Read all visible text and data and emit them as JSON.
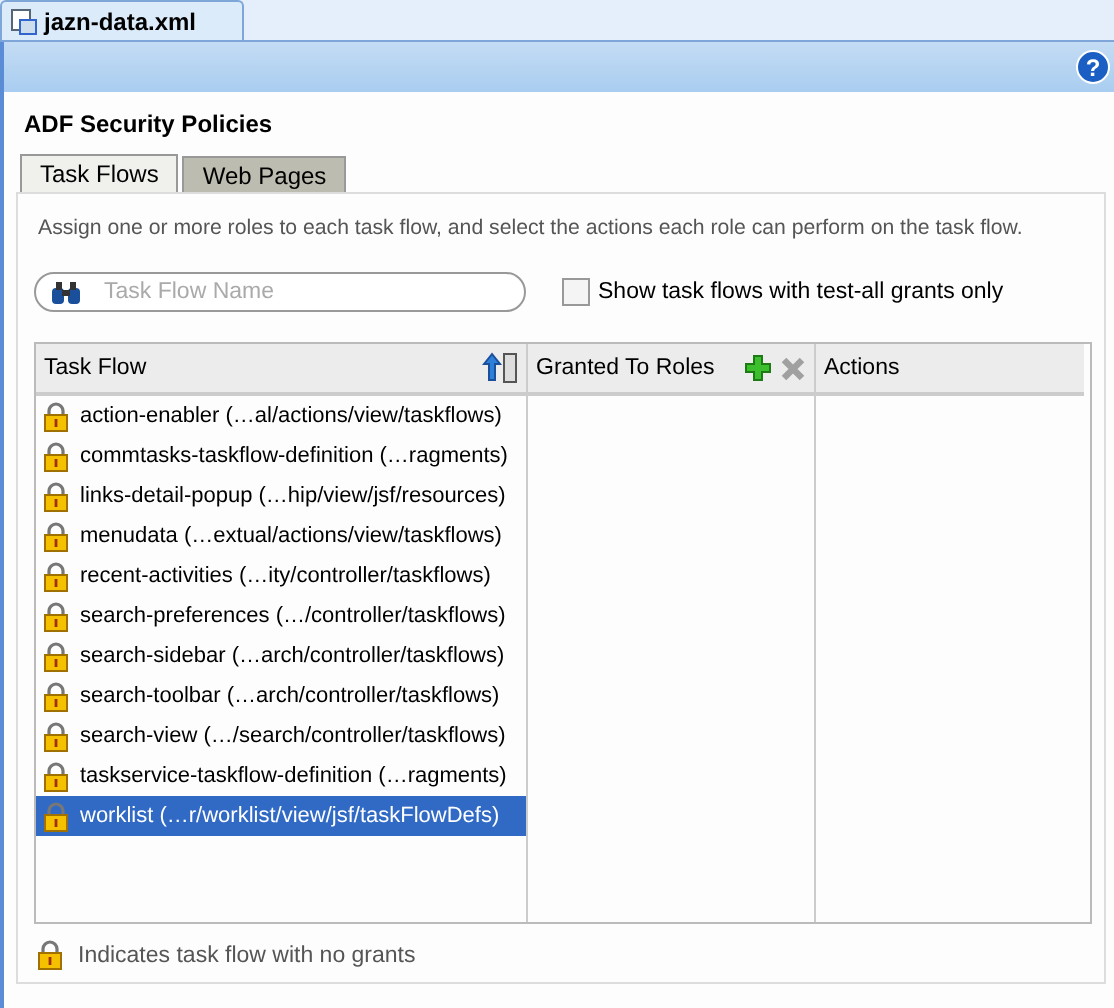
{
  "document_tab": {
    "title": "jazn-data.xml"
  },
  "help_button": "?",
  "heading": "ADF Security Policies",
  "tabs": [
    {
      "label": "Task Flows",
      "selected": true
    },
    {
      "label": "Web Pages",
      "selected": false
    }
  ],
  "description": "Assign one or more roles to each task flow, and select the actions each role can perform on the task flow.",
  "search": {
    "placeholder": "Task Flow Name"
  },
  "filter_checkbox": {
    "label": "Show task flows with test-all grants only",
    "checked": false
  },
  "table": {
    "columns": [
      {
        "label": "Task Flow"
      },
      {
        "label": "Granted To Roles"
      },
      {
        "label": "Actions"
      }
    ],
    "remove_role_disabled": true,
    "rows": [
      {
        "label": "action-enabler (…al/actions/view/taskflows)",
        "selected": false
      },
      {
        "label": "commtasks-taskflow-definition (…ragments)",
        "selected": false
      },
      {
        "label": "links-detail-popup (…hip/view/jsf/resources)",
        "selected": false
      },
      {
        "label": "menudata (…extual/actions/view/taskflows)",
        "selected": false
      },
      {
        "label": "recent-activities (…ity/controller/taskflows)",
        "selected": false
      },
      {
        "label": "search-preferences (…/controller/taskflows)",
        "selected": false
      },
      {
        "label": "search-sidebar (…arch/controller/taskflows)",
        "selected": false
      },
      {
        "label": "search-toolbar (…arch/controller/taskflows)",
        "selected": false
      },
      {
        "label": "search-view (…/search/controller/taskflows)",
        "selected": false
      },
      {
        "label": "taskservice-taskflow-definition (…ragments)",
        "selected": false
      },
      {
        "label": "worklist (…r/worklist/view/jsf/taskFlowDefs)",
        "selected": true
      }
    ]
  },
  "legend": "Indicates task flow with no grants"
}
